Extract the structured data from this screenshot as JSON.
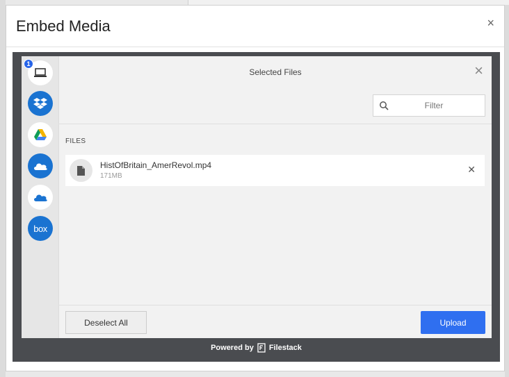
{
  "modal": {
    "title": "Embed Media",
    "close_glyph": "×"
  },
  "picker": {
    "title": "Selected Files",
    "close_glyph": "×",
    "filter": {
      "placeholder": "Filter",
      "value": ""
    },
    "section_label": "FILES",
    "sources": [
      {
        "id": "local",
        "icon": "laptop-icon",
        "badge": "1"
      },
      {
        "id": "dropbox",
        "icon": "dropbox-icon"
      },
      {
        "id": "google-drive",
        "icon": "google-drive-icon"
      },
      {
        "id": "onedrive-business",
        "icon": "onedrive-business-icon"
      },
      {
        "id": "onedrive",
        "icon": "onedrive-icon"
      },
      {
        "id": "box",
        "icon": "box-icon",
        "label": "box"
      }
    ],
    "files": [
      {
        "name": "HistOfBritain_AmerRevol.mp4",
        "size": "171MB",
        "remove_glyph": "✕"
      }
    ],
    "footer": {
      "deselect_label": "Deselect All",
      "upload_label": "Upload"
    }
  },
  "powered_by": {
    "prefix": "Powered by",
    "brand": "Filestack"
  },
  "colors": {
    "accent": "#2f6ff0",
    "source_blue": "#1a73d1",
    "embed_bg": "#4a4c50"
  }
}
